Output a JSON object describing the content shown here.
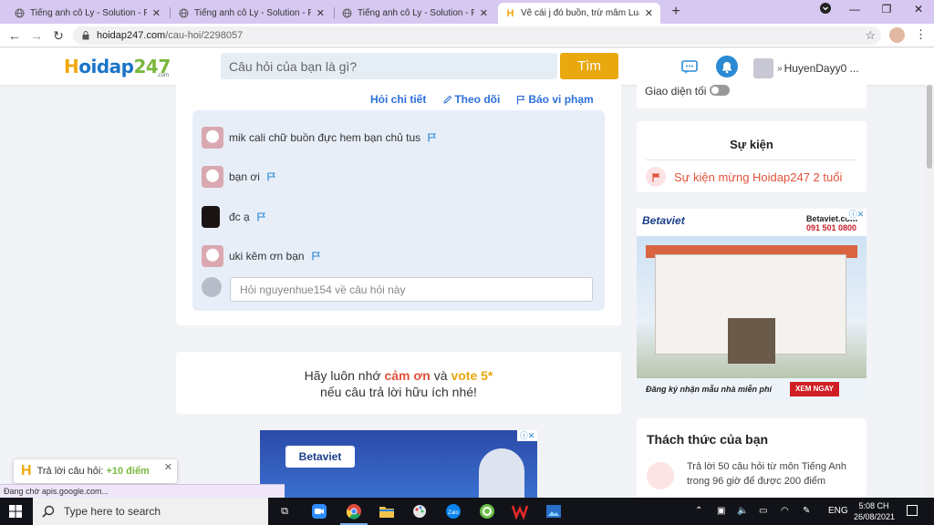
{
  "browser": {
    "tabs": [
      {
        "label": "Tiếng anh cô Ly - Solution - Pre I",
        "active": false
      },
      {
        "label": "Tiếng anh cô Ly - Solution - Pre I",
        "active": false
      },
      {
        "label": "Tiếng anh cô Ly - Solution - Pre I",
        "active": false
      },
      {
        "label": "Vẽ cái j đó buồn, trừ mâm Luật,",
        "active": true
      }
    ],
    "url_host": "hoidap247.com",
    "url_path": "/cau-hoi/2298057"
  },
  "site": {
    "logo_h": "H",
    "logo_text": "oidap",
    "logo_num": "247",
    "logo_sub": ".com",
    "search_placeholder": "Câu hỏi của bạn là gì?",
    "search_button": "Tìm",
    "username": "HuyenDayy0 ..."
  },
  "question": {
    "actions": {
      "detail": "Hỏi chi tiết",
      "follow": "Theo dõi",
      "report": "Báo vi phạm"
    },
    "comments": [
      {
        "text": "mik cali chữ buồn đực hem bạn chủ tus",
        "avatar": "pink"
      },
      {
        "text": "bạn ơi",
        "avatar": "pink"
      },
      {
        "text": "đc ạ",
        "avatar": "dark"
      },
      {
        "text": "uki kêm ơn bạn",
        "avatar": "pink"
      }
    ],
    "reply_placeholder": "Hỏi nguyenhue154 về câu hỏi này"
  },
  "reminder": {
    "prefix": "Hãy luôn nhớ ",
    "thanks": "cảm ơn",
    "and": " và ",
    "vote": "vote 5*",
    "line2": "nếu câu trả lời hữu ích nhé!"
  },
  "sidebar": {
    "dark_mode_label": "Giao diện tối",
    "events_title": "Sự kiện",
    "event_item": "Sự kiện mừng Hoidap247 2 tuổi",
    "challenge_title": "Thách thức của bạn",
    "challenge_text": "Trả lời 50 câu hỏi  từ môn Tiếng Anh trong 96 giờ để được 200 điểm"
  },
  "ads": {
    "right_brand": "Betaviet",
    "right_name": "Betaviet.com",
    "right_phone": "091 501 0800",
    "right_cta_text": "Đăng ký nhận mẫu nhà miễn phí",
    "right_cta_button": "XEM NGAY",
    "bottom_brand": "Betaviet"
  },
  "notification": {
    "text": "Trả lời câu hỏi: ",
    "points": "+10 điểm"
  },
  "status_text": "Đang chờ apis.google.com...",
  "taskbar": {
    "search_placeholder": "Type here to search",
    "lang": "ENG",
    "time": "5:08 CH",
    "date": "26/08/2021"
  }
}
